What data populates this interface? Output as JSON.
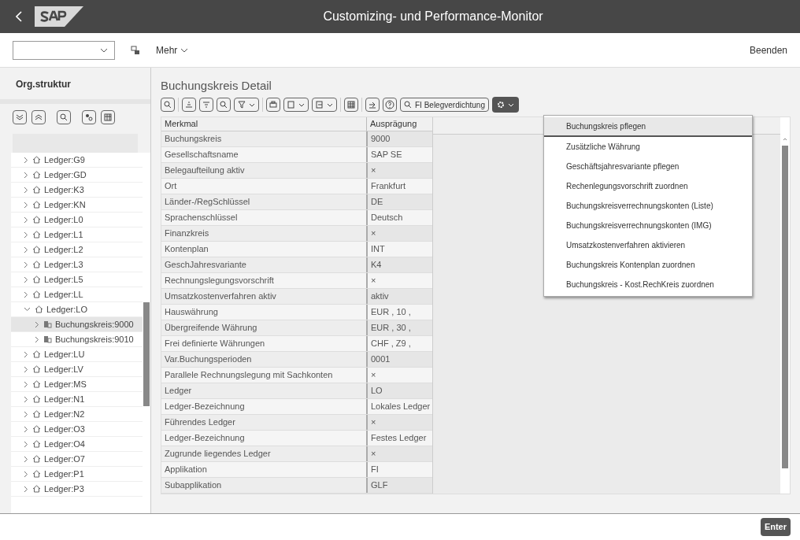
{
  "window": {
    "title": "Customizing- und Performance-Monitor"
  },
  "toolbar": {
    "more_menu": "Mehr",
    "exit_button": "Beenden"
  },
  "sidebar": {
    "title": "Org.struktur",
    "tree": [
      {
        "label": "Ledger:G9",
        "expanded": false,
        "selected": false
      },
      {
        "label": "Ledger:GD",
        "expanded": false,
        "selected": false
      },
      {
        "label": "Ledger:K3",
        "expanded": false,
        "selected": false
      },
      {
        "label": "Ledger:KN",
        "expanded": false,
        "selected": false
      },
      {
        "label": "Ledger:L0",
        "expanded": false,
        "selected": false
      },
      {
        "label": "Ledger:L1",
        "expanded": false,
        "selected": false
      },
      {
        "label": "Ledger:L2",
        "expanded": false,
        "selected": false
      },
      {
        "label": "Ledger:L3",
        "expanded": false,
        "selected": false
      },
      {
        "label": "Ledger:L5",
        "expanded": false,
        "selected": false
      },
      {
        "label": "Ledger:LL",
        "expanded": false,
        "selected": false
      },
      {
        "label": "Ledger:LO",
        "expanded": true,
        "selected": false,
        "children": [
          {
            "label": "Buchungskreis:9000",
            "expanded": false,
            "selected": true
          },
          {
            "label": "Buchungskreis:9010",
            "expanded": false,
            "selected": false
          }
        ]
      },
      {
        "label": "Ledger:LU",
        "expanded": false,
        "selected": false
      },
      {
        "label": "Ledger:LV",
        "expanded": false,
        "selected": false
      },
      {
        "label": "Ledger:MS",
        "expanded": false,
        "selected": false
      },
      {
        "label": "Ledger:N1",
        "expanded": false,
        "selected": false
      },
      {
        "label": "Ledger:N2",
        "expanded": false,
        "selected": false
      },
      {
        "label": "Ledger:O3",
        "expanded": false,
        "selected": false
      },
      {
        "label": "Ledger:O4",
        "expanded": false,
        "selected": false
      },
      {
        "label": "Ledger:O7",
        "expanded": false,
        "selected": false
      },
      {
        "label": "Ledger:P1",
        "expanded": false,
        "selected": false
      },
      {
        "label": "Ledger:P3",
        "expanded": false,
        "selected": false
      }
    ]
  },
  "detail": {
    "title": "Buchungskreis Detail",
    "search_button": "FI Belegverdichtung",
    "table": {
      "columns": [
        "Merkmal",
        "Ausprägung"
      ],
      "rows": [
        [
          "Buchungskreis",
          "9000"
        ],
        [
          "Gesellschaftsname",
          "SAP SE"
        ],
        [
          "Belegaufteilung aktiv",
          "×"
        ],
        [
          "Ort",
          "Frankfurt"
        ],
        [
          "Länder-/RegSchlüssel",
          "DE"
        ],
        [
          "Sprachenschlüssel",
          "Deutsch"
        ],
        [
          "Finanzkreis",
          "×"
        ],
        [
          "Kontenplan",
          "INT"
        ],
        [
          "GeschJahresvariante",
          "K4"
        ],
        [
          "Rechnungslegungsvorschrift",
          "×"
        ],
        [
          "Umsatzkostenverfahren aktiv",
          "aktiv"
        ],
        [
          "Hauswährung",
          "EUR , 10 ,"
        ],
        [
          "Übergreifende Währung",
          "EUR , 30 ,"
        ],
        [
          "Frei definierte Währungen",
          "CHF , Z9 ,"
        ],
        [
          "Var.Buchungsperioden",
          "0001"
        ],
        [
          "Parallele Rechnungslegung mit Sachkonten",
          "×"
        ],
        [
          "Ledger",
          "LO"
        ],
        [
          "Ledger-Bezeichnung",
          "Lokales Ledger"
        ],
        [
          "Führendes Ledger",
          "×"
        ],
        [
          "Ledger-Bezeichnung",
          "Festes Ledger"
        ],
        [
          "Zugrunde liegendes Ledger",
          "×"
        ],
        [
          "Applikation",
          "FI"
        ],
        [
          "Subapplikation",
          "GLF"
        ]
      ]
    }
  },
  "menu": {
    "items": [
      {
        "label": "Buchungskreis pflegen",
        "selected": true
      },
      {
        "label": "Zusätzliche Währung",
        "selected": false
      },
      {
        "label": "Geschäftsjahresvariante pflegen",
        "selected": false
      },
      {
        "label": "Rechenlegungsvorschrift zuordnen",
        "selected": false
      },
      {
        "label": "Buchungskreisverrechnungskonten (Liste)",
        "selected": false
      },
      {
        "label": "Buchungskreisverrechnungskonten (IMG)",
        "selected": false
      },
      {
        "label": "Umsatzkostenverfahren aktivieren",
        "selected": false
      },
      {
        "label": "Buchungskreis Kontenplan zuordnen",
        "selected": false
      },
      {
        "label": "Buchungskreis - Kost.RechKreis zuordnen",
        "selected": false
      }
    ]
  },
  "footer": {
    "enter_button": "Enter"
  }
}
